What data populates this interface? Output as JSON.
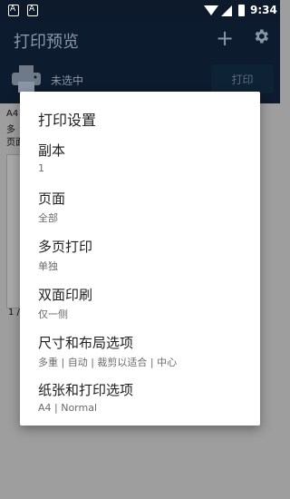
{
  "status_bar": {
    "time": "9:34",
    "icon1": "A",
    "icon2": "A"
  },
  "app_bar": {
    "title": "打印预览",
    "printer_status": "未选中",
    "print_button": "打印"
  },
  "background": {
    "line1": "A4",
    "line2": "多",
    "line3": "页面",
    "page_number": "1 /"
  },
  "dialog": {
    "title": "打印设置",
    "options": [
      {
        "label": "副本",
        "value": "1"
      },
      {
        "label": "页面",
        "value": "全部"
      },
      {
        "label": "多页打印",
        "value": "单独"
      },
      {
        "label": "双面印刷",
        "value": "仅一侧"
      },
      {
        "label": "尺寸和布局选项",
        "value": "多重 | 自动 | 裁剪以适合 | 中心"
      },
      {
        "label": "纸张和打印选项",
        "value": "A4 | Normal"
      }
    ]
  }
}
